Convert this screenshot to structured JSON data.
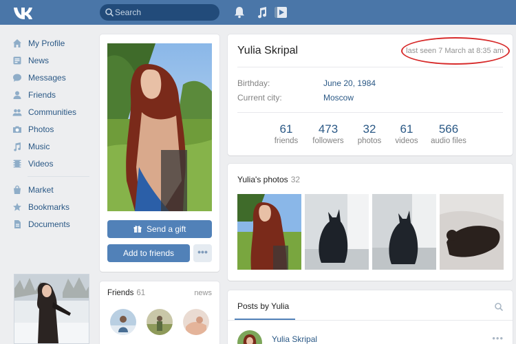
{
  "header": {
    "search_placeholder": "Search"
  },
  "nav": {
    "items": [
      {
        "label": "My Profile",
        "icon": "home-icon"
      },
      {
        "label": "News",
        "icon": "news-icon"
      },
      {
        "label": "Messages",
        "icon": "messages-icon"
      },
      {
        "label": "Friends",
        "icon": "friends-icon"
      },
      {
        "label": "Communities",
        "icon": "communities-icon"
      },
      {
        "label": "Photos",
        "icon": "camera-icon"
      },
      {
        "label": "Music",
        "icon": "music-icon"
      },
      {
        "label": "Videos",
        "icon": "video-icon"
      }
    ],
    "items2": [
      {
        "label": "Market",
        "icon": "market-icon"
      },
      {
        "label": "Bookmarks",
        "icon": "star-icon"
      },
      {
        "label": "Documents",
        "icon": "document-icon"
      }
    ]
  },
  "profile": {
    "name": "Yulia Skripal",
    "last_seen": "last seen 7 March at 8:35 am",
    "birthday_label": "Birthday:",
    "birthday_value": "June 20, 1984",
    "city_label": "Current city:",
    "city_value": "Moscow",
    "counters": [
      {
        "num": "61",
        "label": "friends"
      },
      {
        "num": "473",
        "label": "followers"
      },
      {
        "num": "32",
        "label": "photos"
      },
      {
        "num": "61",
        "label": "videos"
      },
      {
        "num": "566",
        "label": "audio files"
      }
    ]
  },
  "actions": {
    "send_gift": "Send a gift",
    "add_friends": "Add to friends",
    "more": "•••"
  },
  "friends_block": {
    "title": "Friends",
    "count": "61",
    "news_link": "news"
  },
  "photos_block": {
    "title": "Yulia's photos",
    "count": "32"
  },
  "posts": {
    "tab": "Posts by Yulia",
    "author": "Yulia Skripal",
    "more": "•••"
  },
  "colors": {
    "header": "#4a76a8",
    "accent": "#5181b8",
    "link": "#2a5885",
    "annotation": "#d72a2a"
  }
}
